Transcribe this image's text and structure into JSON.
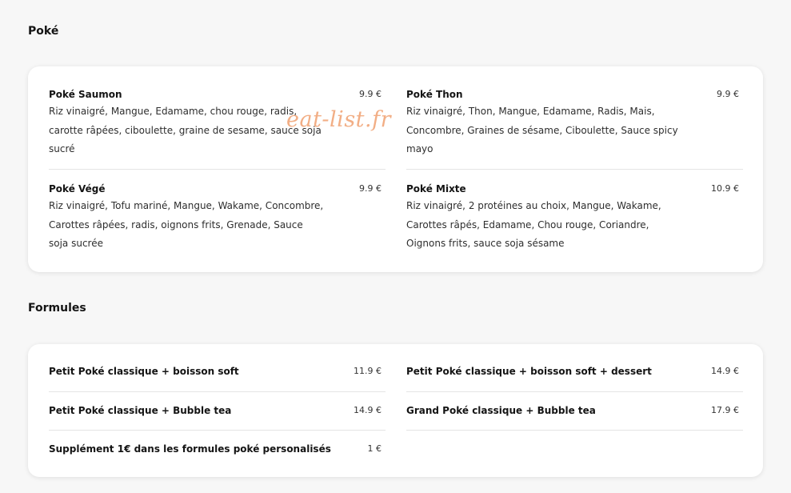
{
  "sections": [
    {
      "title": "Poké",
      "left_items": [
        {
          "name": "Poké Saumon",
          "price": "9.9 €",
          "description": "Riz vinaigré, Mangue, Edamame, chou rouge, radis, carotte râpées, ciboulette, graine de sesame, sauce soja sucré"
        },
        {
          "name": "Poké Végé",
          "price": "9.9 €",
          "description": "Riz vinaigré, Tofu mariné, Mangue, Wakame, Concombre, Carottes râpées, radis, oignons frits, Grenade, Sauce soja sucrée"
        }
      ],
      "right_items": [
        {
          "name": "Poké Thon",
          "price": "9.9 €",
          "description": "Riz vinaigré, Thon, Mangue, Edamame, Radis, Mais, Concombre, Graines de sésame, Ciboulette, Sauce spicy mayo"
        },
        {
          "name": "Poké Mixte",
          "price": "10.9 €",
          "description": "Riz vinaigré, 2 protéines au choix, Mangue, Wakame, Carottes râpés, Edamame, Chou rouge, Coriandre, Oignons frits, sauce soja sésame"
        }
      ]
    },
    {
      "title": "Formules",
      "left_items": [
        {
          "name": "Petit Poké classique + boisson soft",
          "price": "11.9 €"
        },
        {
          "name": "Petit Poké classique + Bubble tea",
          "price": "14.9 €"
        },
        {
          "name": "Supplément 1€ dans les formules poké personalisés",
          "price": "1 €"
        }
      ],
      "right_items": [
        {
          "name": "Petit Poké classique + boisson soft + dessert",
          "price": "14.9 €"
        },
        {
          "name": "Grand Poké classique + Bubble tea",
          "price": "17.9 €"
        }
      ]
    }
  ],
  "watermark": "eat-list.fr"
}
